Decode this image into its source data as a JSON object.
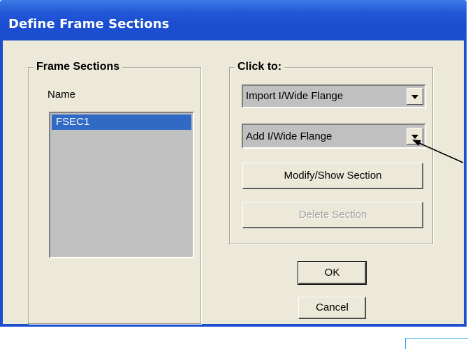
{
  "window": {
    "title": "Define Frame Sections"
  },
  "frame_sections": {
    "group_label": "Frame Sections",
    "name_label": "Name",
    "items": [
      "FSEC1"
    ],
    "selected": "FSEC1"
  },
  "click_to": {
    "group_label": "Click to:",
    "import_combo": "Import I/Wide Flange",
    "add_combo": "Add I/Wide Flange",
    "modify_button": "Modify/Show Section",
    "delete_button": "Delete Section"
  },
  "dialog_buttons": {
    "ok": "OK",
    "cancel": "Cancel"
  },
  "icons": {
    "dropdown": "chevron-down-icon",
    "annotation": "pointer-arrow-icon"
  },
  "colors": {
    "title_bar": "#1c4fd0",
    "selection": "#316ac5",
    "face": "#ece9d8",
    "list_bg": "#c0c0c0"
  }
}
